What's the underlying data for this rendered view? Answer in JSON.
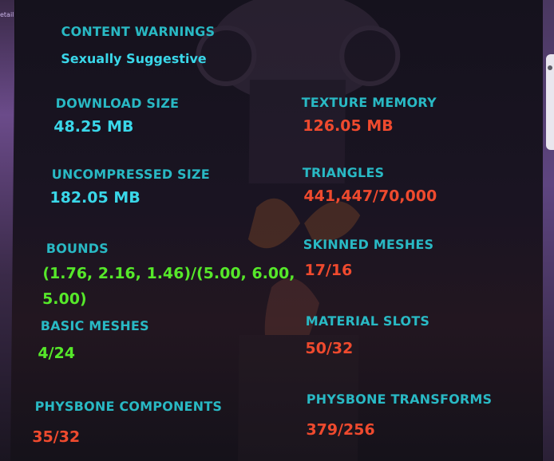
{
  "content_warnings": {
    "label": "CONTENT WARNINGS",
    "value": "Sexually Suggestive"
  },
  "stats": {
    "download_size": {
      "label": "DOWNLOAD SIZE",
      "value": "48.25 MB",
      "status_color": "#3ad7e9"
    },
    "texture_memory": {
      "label": "TEXTURE MEMORY",
      "value": "126.05 MB",
      "status_color": "#ef4a2e"
    },
    "uncompressed_size": {
      "label": "UNCOMPRESSED SIZE",
      "value": "182.05 MB",
      "status_color": "#3ad7e9"
    },
    "triangles": {
      "label": "TRIANGLES",
      "value": "441,447/70,000",
      "status_color": "#ef4a2e"
    },
    "bounds": {
      "label": "BOUNDS",
      "value_line1": "(1.76, 2.16, 1.46)/(5.00, 6.00,",
      "value_line2": "5.00)",
      "status_color": "#56e82a"
    },
    "skinned_meshes": {
      "label": "SKINNED MESHES",
      "value": "17/16",
      "status_color": "#ef4a2e"
    },
    "basic_meshes": {
      "label": "BASIC MESHES",
      "value": "4/24",
      "status_color": "#56e82a"
    },
    "material_slots": {
      "label": "MATERIAL SLOTS",
      "value": "50/32",
      "status_color": "#ef4a2e"
    },
    "physbone_components": {
      "label": "PHYSBONE COMPONENTS",
      "value": "35/32",
      "status_color": "#ef4a2e"
    },
    "physbone_transforms": {
      "label": "PHYSBONE TRANSFORMS",
      "value": "379/256",
      "status_color": "#ef4a2e"
    }
  },
  "sidebar_fragment": "etail"
}
